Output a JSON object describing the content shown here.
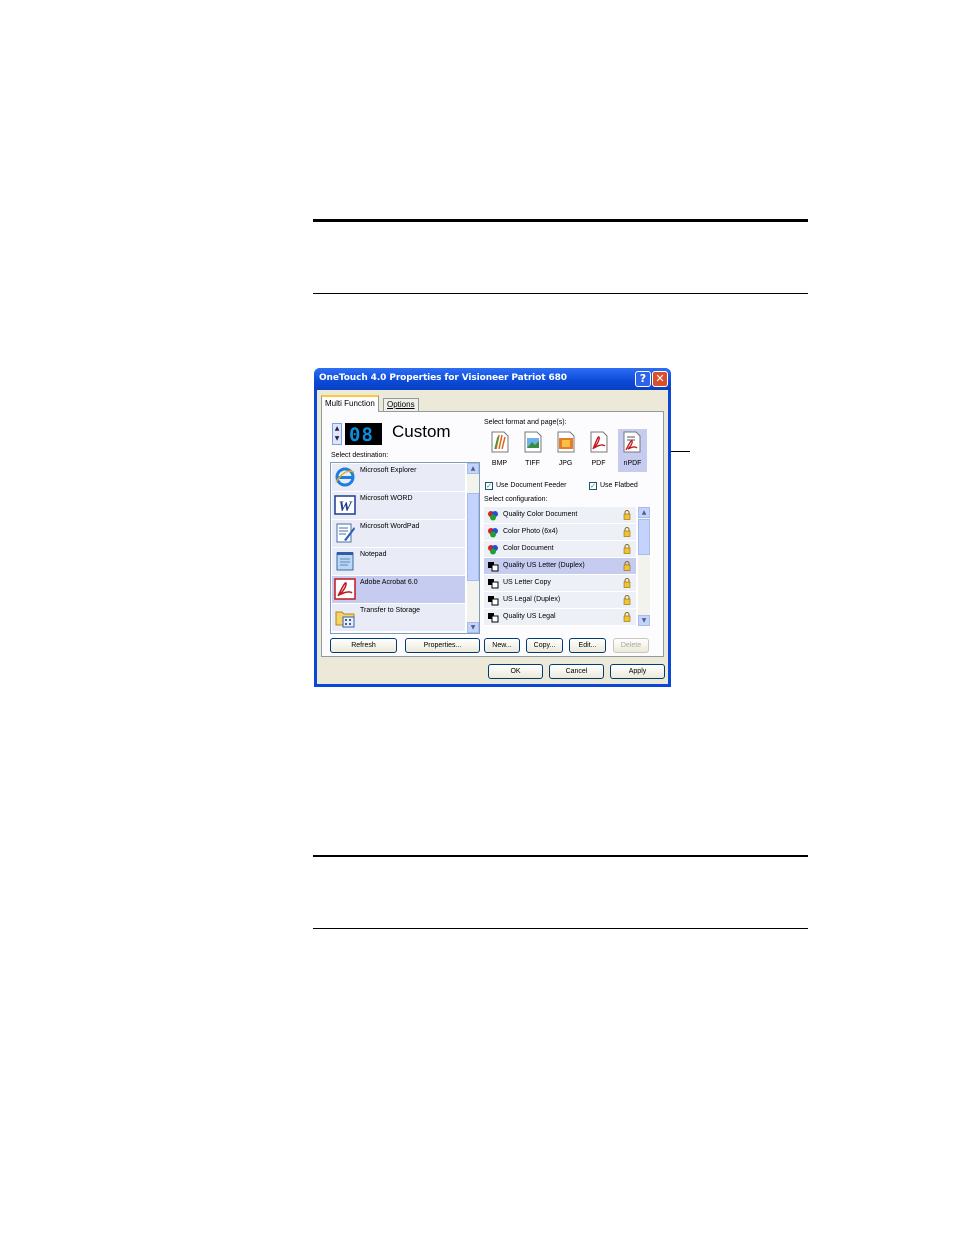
{
  "window": {
    "title": "OneTouch 4.0 Properties for Visioneer Patriot 680",
    "help_glyph": "?",
    "close_glyph": "✕"
  },
  "tabs": [
    {
      "label": "Multi Function",
      "active": true
    },
    {
      "label": "Options",
      "active": false
    }
  ],
  "button_number": "08",
  "button_name": "Custom",
  "destination": {
    "label": "Select destination:",
    "items": [
      {
        "label": "Microsoft Explorer",
        "icon": "internet-explorer-icon",
        "selected": false
      },
      {
        "label": "Microsoft WORD",
        "icon": "word-icon",
        "selected": false
      },
      {
        "label": "Microsoft WordPad",
        "icon": "wordpad-icon",
        "selected": false
      },
      {
        "label": "Notepad",
        "icon": "notepad-icon",
        "selected": false
      },
      {
        "label": "Adobe Acrobat 6.0",
        "icon": "acrobat-icon",
        "selected": true
      },
      {
        "label": "Transfer to Storage",
        "icon": "storage-icon",
        "selected": false
      }
    ],
    "refresh_label": "Refresh",
    "properties_label": "Properties..."
  },
  "format": {
    "label": "Select format and page(s):",
    "items": [
      {
        "label": "BMP",
        "icon": "bmp-icon",
        "selected": false
      },
      {
        "label": "TIFF",
        "icon": "tiff-icon",
        "selected": false
      },
      {
        "label": "JPG",
        "icon": "jpg-icon",
        "selected": false
      },
      {
        "label": "PDF",
        "icon": "pdf-icon",
        "selected": false
      },
      {
        "label": "nPDF",
        "icon": "npdf-icon",
        "selected": true
      }
    ],
    "use_document_feeder": {
      "label": "Use Document Feeder",
      "checked": true
    },
    "use_flatbed": {
      "label": "Use Flatbed",
      "checked": true
    }
  },
  "configuration": {
    "label": "Select configuration:",
    "items": [
      {
        "label": "Quality Color Document",
        "icon": "color-config-icon",
        "selected": false
      },
      {
        "label": "Color Photo (6x4)",
        "icon": "color-config-icon",
        "selected": false
      },
      {
        "label": "Color Document",
        "icon": "color-config-icon",
        "selected": false
      },
      {
        "label": "Quality US Letter (Duplex)",
        "icon": "bw-config-icon",
        "selected": true
      },
      {
        "label": "US Letter Copy",
        "icon": "bw-config-icon",
        "selected": false
      },
      {
        "label": "US Legal (Duplex)",
        "icon": "bw-config-icon",
        "selected": false
      },
      {
        "label": "Quality US Legal",
        "icon": "bw-config-icon",
        "selected": false
      }
    ],
    "new_label": "New...",
    "copy_label": "Copy...",
    "edit_label": "Edit...",
    "delete_label": "Delete"
  },
  "footer": {
    "ok_label": "OK",
    "cancel_label": "Cancel",
    "apply_label": "Apply"
  },
  "colors": {
    "titlebar": "#0a4ad6",
    "selection": "#c6cbf0",
    "dialog_face": "#ece9d8"
  }
}
